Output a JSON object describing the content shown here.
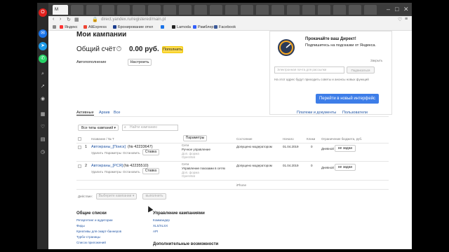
{
  "browser": {
    "tab_active_label": "M",
    "tabs_misc": [
      "",
      "",
      "",
      "",
      "",
      ""
    ],
    "url": "direct.yandex.ru/registered/main.pl",
    "bookmarks": [
      "Яндекс",
      "AliExpress",
      "Бронирование отел",
      "",
      "Lamoda",
      "Рамблер",
      "Facebook"
    ]
  },
  "page": {
    "title": "Мои кампании",
    "account": {
      "label": "Общий счёт",
      "balance": "0.00 руб.",
      "topup_button": "Пополнить",
      "autotopup_label": "Автопополнение",
      "configure_button": "Настроить"
    },
    "promo": {
      "title": "Прокачайте ваш Директ!",
      "subtitle": "Подпишитесь на подсказки от Яндекса.",
      "close_link": "Закрыть",
      "email_placeholder": "Электронная почта для рассылки",
      "subscribe_button": "Подписаться",
      "footnote": "На этот адрес будут приходить советы и анонсы новых функций",
      "new_interface_button": "Перейти в новый интерфейс"
    },
    "tabs": [
      "Активные",
      "Архив",
      "Все"
    ],
    "top_links": [
      "Платежи и документы",
      "Пользователи"
    ],
    "filter_select": "Все типы кампаний",
    "search_placeholder": "Найти кампанию",
    "params_button": "Параметры",
    "table": {
      "headers": [
        "Название / № Т",
        "",
        "Состояние",
        "Начало",
        "Клики",
        "Ограничение бюджета, руб."
      ],
      "rows": [
        {
          "num": "1",
          "name": "Автокраны_[Поиск]",
          "id": "(№ 42233647)",
          "actions": [
            "Удалить",
            "Параметры",
            "Остановить"
          ],
          "stake_button": "Ставка",
          "network": "Сети",
          "strategy": "Ручное управление",
          "extra": [
            "Доп. форма",
            "OpenStat"
          ],
          "status": "Допущено модератором",
          "start": "01.04.2019",
          "clicks": "0",
          "budget_mode": "Дневной",
          "budget_value": "не задан"
        },
        {
          "num": "2",
          "name": "Автокраны_[РСЯ]",
          "id": "(№ 42235510)",
          "actions": [
            "Удалить",
            "Параметры",
            "Остановить"
          ],
          "stake_button": "Ставка",
          "network": "Сети",
          "strategy": "Управление показами в сетях",
          "extra": [
            "Доп. форма",
            "OpenStat"
          ],
          "status": "Допущено модератором",
          "start": "01.04.2019",
          "clicks": "0",
          "budget_mode": "Дневной",
          "budget_value": "не задан"
        }
      ],
      "footer_device": "iPhone"
    },
    "bulk": {
      "label": "Действие:",
      "select": "Выберите кампании",
      "run_button": "выполнить"
    },
    "footer": {
      "general_title": "Общие списки",
      "general_links": [
        "Ретаргетинг и аудитории",
        "Фиды",
        "Креативы для смарт-баннеров",
        "Турбо-страницы",
        "Список приложений"
      ],
      "mgmt_title": "Управление кампаниями",
      "mgmt_links": [
        "Коммандер",
        "XLS/XLSX",
        "API"
      ],
      "extra_title": "Дополнительные возможности"
    }
  }
}
